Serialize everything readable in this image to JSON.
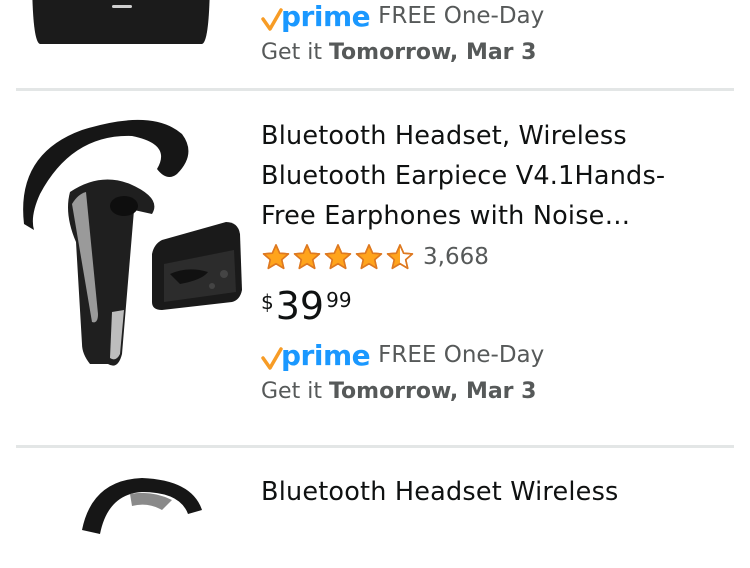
{
  "results": [
    {
      "prime_label": "prime",
      "shipping": "FREE One-Day",
      "delivery_prefix": "Get it",
      "delivery_date": "Tomorrow, Mar 3"
    },
    {
      "title": "Bluetooth Headset, Wireless Bluetooth Earpiece V4.1Hands-Free Earphones with Noise…",
      "title_lines": [
        "Bluetooth Headset, Wireless",
        "Bluetooth Earpiece V4.1Hands-",
        "Free Earphones with Noise…"
      ],
      "rating": 4.5,
      "review_count": "3,668",
      "price": {
        "symbol": "$",
        "whole": "39",
        "fraction": "99"
      },
      "prime_label": "prime",
      "shipping": "FREE One-Day",
      "delivery_prefix": "Get it",
      "delivery_date": "Tomorrow, Mar 3"
    },
    {
      "title_lines": [
        "Bluetooth Headset Wireless"
      ]
    }
  ],
  "colors": {
    "star": "#ffa41c",
    "prime_blue": "#1a98ff",
    "prime_check": "#f79c26",
    "divider": "#e3e6e6",
    "secondary_text": "#565959"
  },
  "icons": [
    "star-full-icon",
    "star-half-icon",
    "prime-check-icon",
    "product-image-charging-case",
    "product-image-headset"
  ]
}
